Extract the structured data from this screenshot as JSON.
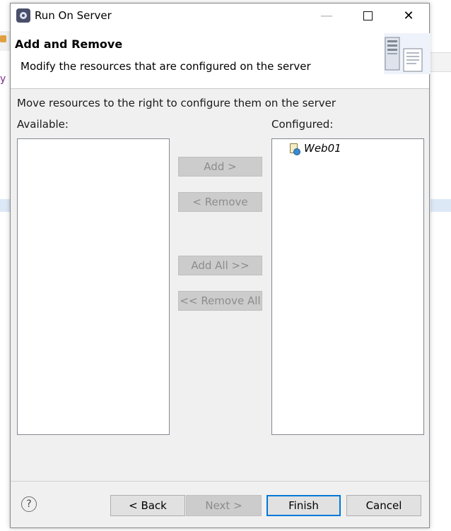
{
  "window": {
    "title": "Run On Server",
    "icon": "server-gear-icon",
    "controls": [
      "minimize-icon",
      "maximize-icon",
      "close-icon"
    ]
  },
  "header": {
    "title": "Add and Remove",
    "description": "Modify the resources that are configured on the server",
    "graphic": "server-documents-icon"
  },
  "main": {
    "instruction": "Move resources to the right to configure them on the server",
    "available_label": "Available:",
    "configured_label": "Configured:",
    "available_items": [],
    "configured_items": [
      {
        "name": "Web01",
        "icon": "web-module-icon"
      }
    ]
  },
  "transfer_buttons": {
    "add": "Add >",
    "remove": "< Remove",
    "add_all": "Add All >>",
    "remove_all": "<< Remove All"
  },
  "footer": {
    "help_icon": "help-icon",
    "back": "< Back",
    "next": "Next >",
    "finish": "Finish",
    "cancel": "Cancel"
  },
  "colors": {
    "focus_border": "#0078d7",
    "dialog_bg": "#f0f0f0",
    "disabled_text": "#8c8c8c"
  }
}
